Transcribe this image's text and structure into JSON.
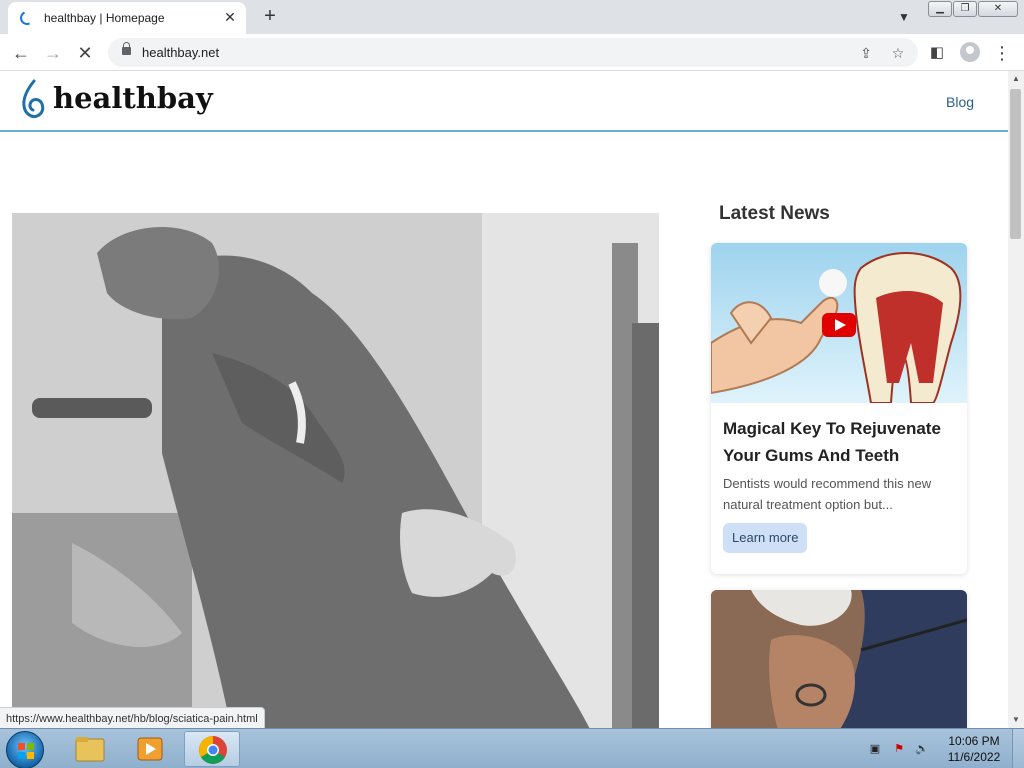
{
  "browser": {
    "tab_title": "healthbay | Homepage",
    "tab_close": "✕",
    "new_tab": "+",
    "url": "healthbay.net",
    "status_url": "https://www.healthbay.net/hb/blog/sciatica-pain.html"
  },
  "site": {
    "logo_text": "healthbay",
    "nav": {
      "blog": "Blog"
    },
    "brand_color": "#6aaecf"
  },
  "latest_news": {
    "heading": "Latest News",
    "cards": [
      {
        "title": "Magical Key To Rejuvenate Your Gums And Teeth",
        "description": "Dentists would recommend this new natural treatment option but...",
        "button": "Learn more"
      }
    ]
  },
  "taskbar": {
    "time": "10:06 PM",
    "date": "11/6/2022"
  }
}
